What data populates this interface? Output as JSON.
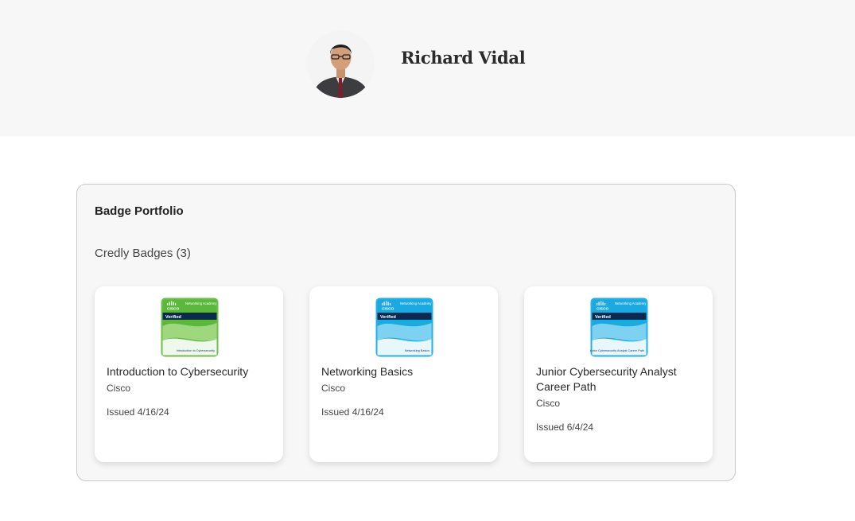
{
  "profile": {
    "name": "Richard Vidal"
  },
  "portfolio": {
    "title": "Badge Portfolio",
    "section_label": "Credly Badges (3)",
    "badges": [
      {
        "name": "Introduction to Cybersecurity",
        "issuer": "Cisco",
        "issued": "Issued 4/16/24",
        "badge_text": {
          "brand": "CISCO",
          "program": "Networking Academy",
          "status": "Verified",
          "caption": "Introduction to Cybersecurity"
        },
        "colors": {
          "primary": "#5cb83c",
          "light": "#9fd77e",
          "frame": "#6fbf4a"
        }
      },
      {
        "name": "Networking Basics",
        "issuer": "Cisco",
        "issued": "Issued 4/16/24",
        "badge_text": {
          "brand": "CISCO",
          "program": "Networking Academy",
          "status": "Verified",
          "caption": "Networking Basics"
        },
        "colors": {
          "primary": "#1aa9e0",
          "light": "#7fd1f2",
          "frame": "#29b0e3"
        }
      },
      {
        "name": "Junior Cybersecurity Analyst Career Path",
        "issuer": "Cisco",
        "issued": "Issued 6/4/24",
        "badge_text": {
          "brand": "CISCO",
          "program": "Networking Academy",
          "status": "Verified",
          "caption": "Junior Cybersecurity Analyst Career Path"
        },
        "colors": {
          "primary": "#1aa9e0",
          "light": "#7fd1f2",
          "frame": "#29b0e3"
        }
      }
    ]
  }
}
